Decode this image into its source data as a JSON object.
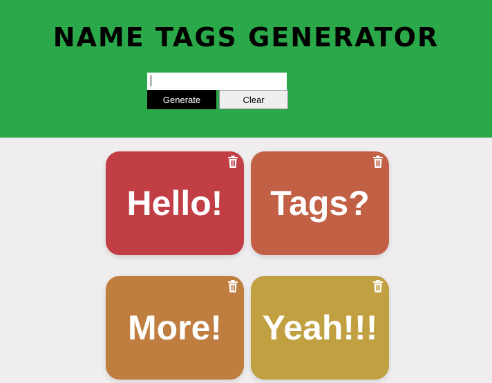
{
  "header": {
    "title": "NAME TAGS GENERATOR",
    "color": "#2ba84a"
  },
  "form": {
    "input_value": "",
    "generate_label": "Generate",
    "clear_label": "Clear"
  },
  "tags": [
    {
      "text": "Hello!",
      "color": "#c03e44",
      "delete_icon": "trash-icon"
    },
    {
      "text": "Tags?",
      "color": "#c26046",
      "delete_icon": "trash-icon"
    },
    {
      "text": "More!",
      "color": "#c07d40",
      "delete_icon": "trash-icon"
    },
    {
      "text": "Yeah!!!",
      "color": "#c0a040",
      "delete_icon": "trash-icon"
    }
  ]
}
